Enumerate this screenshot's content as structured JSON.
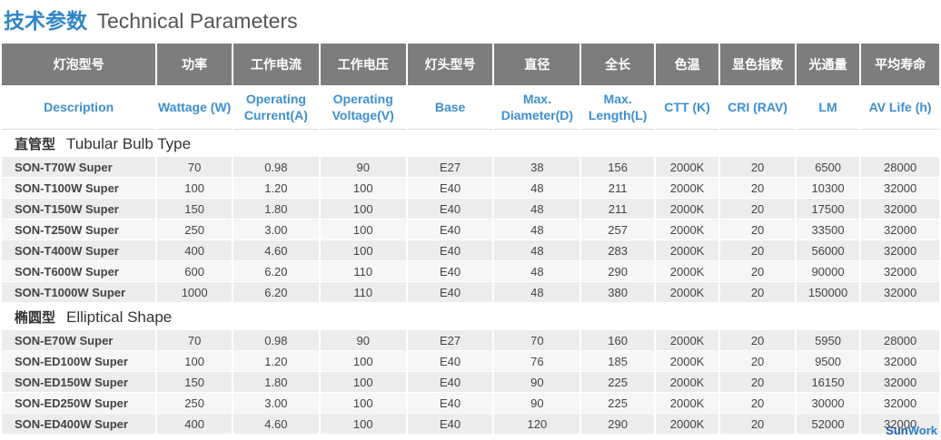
{
  "title": {
    "cn": "技术参数",
    "en": "Technical Parameters"
  },
  "columns_cn": [
    "灯泡型号",
    "功率",
    "工作电流",
    "工作电压",
    "灯头型号",
    "直径",
    "全长",
    "色温",
    "显色指数",
    "光通量",
    "平均寿命"
  ],
  "columns_en": [
    "Description",
    "Wattage (W)",
    "Operating Current(A)",
    "Operating Voltage(V)",
    "Base",
    "Max. Diameter(D)",
    "Max. Length(L)",
    "CTT (K)",
    "CRI (RAV)",
    "LM",
    "AV Life (h)"
  ],
  "sections": [
    {
      "cn": "直管型",
      "en": "Tubular Bulb Type",
      "rows": [
        [
          "SON-T70W Super",
          "70",
          "0.98",
          "90",
          "E27",
          "38",
          "156",
          "2000K",
          "20",
          "6500",
          "28000"
        ],
        [
          "SON-T100W Super",
          "100",
          "1.20",
          "100",
          "E40",
          "48",
          "211",
          "2000K",
          "20",
          "10300",
          "32000"
        ],
        [
          "SON-T150W Super",
          "150",
          "1.80",
          "100",
          "E40",
          "48",
          "211",
          "2000K",
          "20",
          "17500",
          "32000"
        ],
        [
          "SON-T250W Super",
          "250",
          "3.00",
          "100",
          "E40",
          "48",
          "257",
          "2000K",
          "20",
          "33500",
          "32000"
        ],
        [
          "SON-T400W Super",
          "400",
          "4.60",
          "100",
          "E40",
          "48",
          "283",
          "2000K",
          "20",
          "56000",
          "32000"
        ],
        [
          "SON-T600W Super",
          "600",
          "6.20",
          "110",
          "E40",
          "48",
          "290",
          "2000K",
          "20",
          "90000",
          "32000"
        ],
        [
          "SON-T1000W Super",
          "1000",
          "6.20",
          "110",
          "E40",
          "48",
          "380",
          "2000K",
          "20",
          "150000",
          "32000"
        ]
      ]
    },
    {
      "cn": "椭圆型",
      "en": "Elliptical Shape",
      "rows": [
        [
          "SON-E70W Super",
          "70",
          "0.98",
          "90",
          "E27",
          "70",
          "160",
          "2000K",
          "20",
          "5950",
          "28000"
        ],
        [
          "SON-ED100W Super",
          "100",
          "1.20",
          "100",
          "E40",
          "76",
          "185",
          "2000K",
          "20",
          "9500",
          "32000"
        ],
        [
          "SON-ED150W Super",
          "150",
          "1.80",
          "100",
          "E40",
          "90",
          "225",
          "2000K",
          "20",
          "16150",
          "32000"
        ],
        [
          "SON-ED250W Super",
          "250",
          "3.00",
          "100",
          "E40",
          "90",
          "225",
          "2000K",
          "20",
          "30000",
          "32000"
        ],
        [
          "SON-ED400W Super",
          "400",
          "4.60",
          "100",
          "E40",
          "120",
          "290",
          "2000K",
          "20",
          "52000",
          "32000"
        ]
      ]
    }
  ],
  "brand": {
    "a": "Sun",
    "b": "Work"
  },
  "colors": {
    "title_cn": "#2f86c6",
    "header_bg": "#7d7d7d",
    "header_en": "#3d8fd0",
    "row_odd": "#ececec",
    "row_even": "#f6f6f6"
  }
}
